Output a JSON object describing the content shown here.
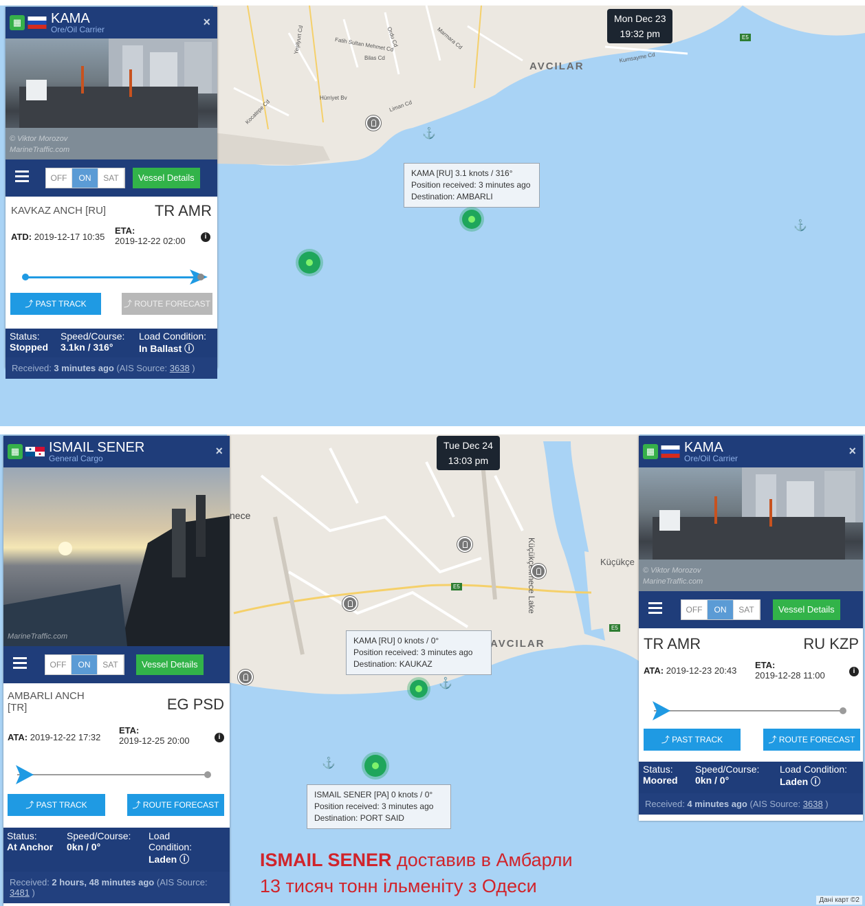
{
  "top": {
    "timestamp": {
      "day": "Mon Dec 23",
      "time": "19:32 pm"
    },
    "place_label": "AVCILAR",
    "roads": [
      "Fatih Sultan Mehmet Cd",
      "Bilas Cd",
      "Hürriyet Bv",
      "Liman Cd",
      "Marmara Cd",
      "Kocatepe Cd",
      "Kumsayme Cd",
      "Yeşilyurt Cd",
      "Ordu Cd"
    ],
    "highway_badge": "E5",
    "tooltip": {
      "line1": "KAMA [RU] 3.1 knots / 316°",
      "line2": "Position received: 3 minutes ago",
      "line3": "Destination: AMBARLI"
    },
    "panel": {
      "name": "KAMA",
      "type": "Ore/Oil Carrier",
      "close": "×",
      "photo_credit1": "© Viktor Morozov",
      "photo_credit2": "MarineTraffic.com",
      "toggle": [
        "OFF",
        "ON",
        "SAT"
      ],
      "details_btn": "Vessel Details",
      "from_port": "KAVKAZ ANCH [RU]",
      "to_port": "TR AMR",
      "time_label": "ATD:",
      "time_value": "2019-12-17 10:35",
      "eta_label": "ETA:",
      "eta_value": "2019-12-22 02:00",
      "past_track": "PAST TRACK",
      "route_forecast": "ROUTE FORECAST",
      "progress": 0.93,
      "status_k": "Status:",
      "status_v": "Stopped",
      "speed_k": "Speed/Course:",
      "speed_v": "3.1kn / 316°",
      "load_k": "Load Condition:",
      "load_v": "In Ballast",
      "received_pre": "Received: ",
      "received_b": "3 minutes ago",
      "received_mid": " (AIS Source: ",
      "received_src": "3638",
      "received_end": " )"
    }
  },
  "bottom": {
    "timestamp": {
      "day": "Tue Dec 24",
      "time": "13:03 pm"
    },
    "place_labels": [
      "AVCILAR",
      "Küçükçekmece Lake",
      "Küçükçe",
      "nece"
    ],
    "highway_badge": "E5",
    "tooltip_kama": {
      "line1": "KAMA [RU] 0 knots / 0°",
      "line2": "Position received: 3 minutes ago",
      "line3": "Destination: KAUKAZ"
    },
    "tooltip_ismail": {
      "line1": "ISMAIL SENER [PA] 0 knots / 0°",
      "line2": "Position received: 3 minutes ago",
      "line3": "Destination: PORT SAID"
    },
    "caption_bold": "ISMAIL SENER",
    "caption_rest": " доставив в Амбарли",
    "caption_line2": "13 тисяч тонн ільменіту з Одеси",
    "attribution": "Дані карт ©2",
    "panel_left": {
      "name": "ISMAIL SENER",
      "type": "General Cargo",
      "close": "×",
      "photo_credit": "MarineTraffic.com",
      "toggle": [
        "OFF",
        "ON",
        "SAT"
      ],
      "details_btn": "Vessel Details",
      "from_port": "AMBARLI ANCH [TR]",
      "to_port": "EG PSD",
      "time_label": "ATA:",
      "time_value": "2019-12-22 17:32",
      "eta_label": "ETA:",
      "eta_value": "2019-12-25 20:00",
      "past_track": "PAST TRACK",
      "route_forecast": "ROUTE FORECAST",
      "progress": 0.0,
      "status_k": "Status:",
      "status_v": "At Anchor",
      "speed_k": "Speed/Course:",
      "speed_v": "0kn / 0°",
      "load_k": "Load Condition:",
      "load_v": "Laden",
      "received_pre": "Received: ",
      "received_b": "2 hours, 48 minutes ago",
      "received_mid": " (AIS Source: ",
      "received_src": "3481",
      "received_end": " )"
    },
    "panel_right": {
      "name": "KAMA",
      "type": "Ore/Oil Carrier",
      "close": "×",
      "photo_credit1": "© Viktor Morozov",
      "photo_credit2": "MarineTraffic.com",
      "toggle": [
        "OFF",
        "ON",
        "SAT"
      ],
      "details_btn": "Vessel Details",
      "from_port": "TR AMR",
      "to_port": "RU KZP",
      "time_label": "ATA:",
      "time_value": "2019-12-23 20:43",
      "eta_label": "ETA:",
      "eta_value": "2019-12-28 11:00",
      "past_track": "PAST TRACK",
      "route_forecast": "ROUTE FORECAST",
      "progress": 0.0,
      "status_k": "Status:",
      "status_v": "Moored",
      "speed_k": "Speed/Course:",
      "speed_v": "0kn / 0°",
      "load_k": "Load Condition:",
      "load_v": "Laden",
      "received_pre": "Received: ",
      "received_b": "4 minutes ago",
      "received_mid": " (AIS Source: ",
      "received_src": "3638",
      "received_end": " )"
    }
  },
  "colors": {
    "sea": "#a9d3f5",
    "land": "#ece8e1",
    "panel_navy": "#1f3d7a",
    "button_blue": "#1f9ae3",
    "button_green": "#32b349",
    "caption_red": "#d0242b"
  }
}
